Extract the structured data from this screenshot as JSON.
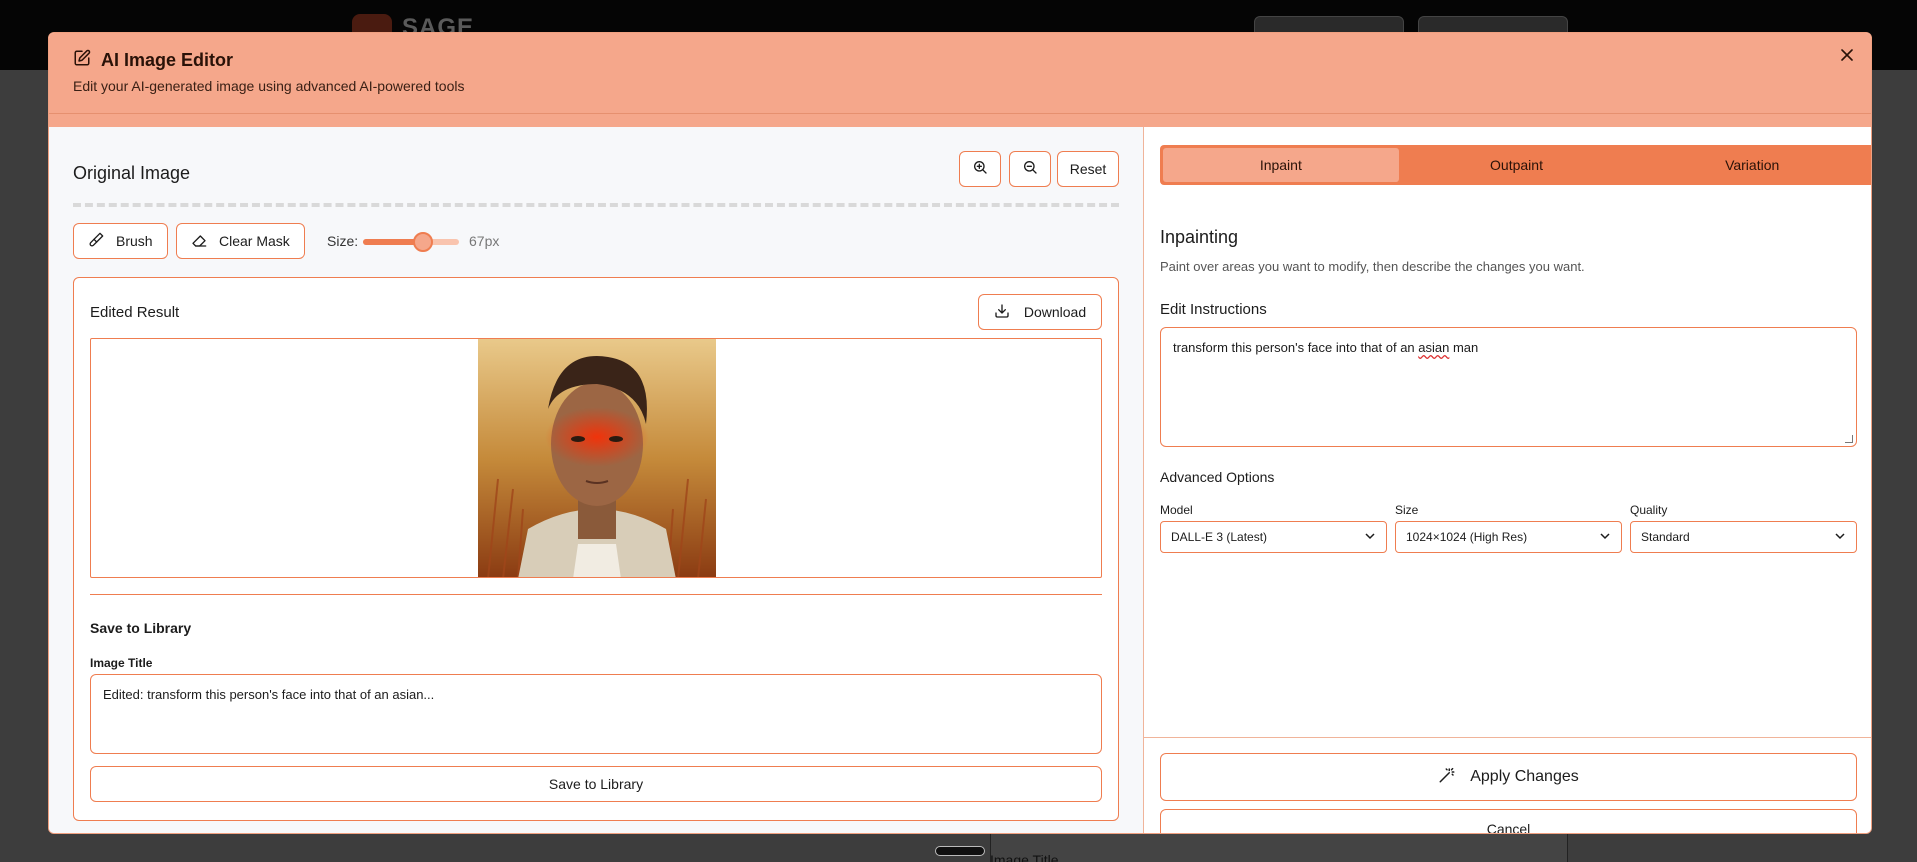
{
  "background": {
    "logo_text": "SAGE",
    "bottom_label": "Image Title"
  },
  "modal": {
    "title": "AI Image Editor",
    "subtitle": "Edit your AI-generated image using advanced AI-powered tools",
    "close_icon": "close-icon"
  },
  "original": {
    "title": "Original Image",
    "zoom_in_icon": "zoom-in-icon",
    "zoom_out_icon": "zoom-out-icon",
    "reset_label": "Reset"
  },
  "tools": {
    "brush_label": "Brush",
    "clear_mask_label": "Clear Mask",
    "size_label": "Size:",
    "size_value": "67px",
    "size_fraction": 0.62
  },
  "result": {
    "title": "Edited Result",
    "download_label": "Download",
    "save_heading": "Save to Library",
    "image_title_label": "Image Title",
    "image_title_value": "Edited: transform this person's face into that of an asian...",
    "save_button_label": "Save to Library"
  },
  "tabs": [
    {
      "label": "Inpaint",
      "active": true
    },
    {
      "label": "Outpaint",
      "active": false
    },
    {
      "label": "Variation",
      "active": false
    }
  ],
  "inpainting": {
    "title": "Inpainting",
    "description": "Paint over areas you want to modify, then describe the changes you want.",
    "instructions_label": "Edit Instructions",
    "instructions_before": "transform this person's face into that of an ",
    "instructions_misspelled": "asian",
    "instructions_after": " man",
    "advanced_label": "Advanced Options",
    "model_label": "Model",
    "model_value": "DALL-E 3 (Latest)",
    "size_label": "Size",
    "size_value": "1024×1024 (High Res)",
    "quality_label": "Quality",
    "quality_value": "Standard"
  },
  "actions": {
    "apply_label": "Apply Changes",
    "cancel_label": "Cancel"
  },
  "colors": {
    "accent": "#ef7d50",
    "header": "#f5a78b"
  }
}
